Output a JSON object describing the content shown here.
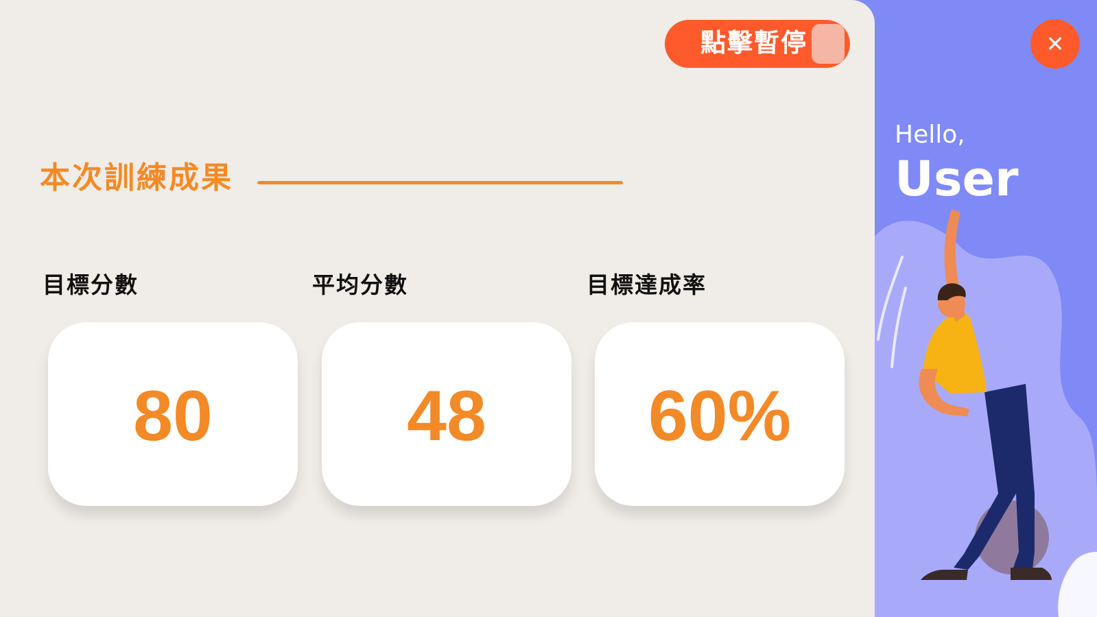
{
  "toolbar": {
    "pause_label": "點擊暫停"
  },
  "results": {
    "title": "本次訓練成果",
    "stats": [
      {
        "label": "目標分數",
        "value": "80"
      },
      {
        "label": "平均分數",
        "value": "48"
      },
      {
        "label": "目標達成率",
        "value": "60%"
      }
    ]
  },
  "side": {
    "greeting": "Hello,",
    "username": "User",
    "close_icon": "close-icon",
    "illustration_icon": "stretching-person-illustration"
  },
  "colors": {
    "accent_orange": "#f28a27",
    "button_red": "#ff5a2b",
    "side_blue": "#7f8af7",
    "background": "#f0ece7"
  }
}
